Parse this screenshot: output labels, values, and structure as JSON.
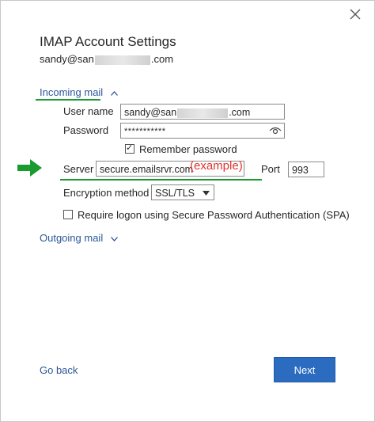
{
  "dialog": {
    "title": "IMAP Account Settings",
    "email_prefix": "sandy@san",
    "email_suffix": ".com"
  },
  "incoming": {
    "header": "Incoming mail",
    "chevron": "^",
    "username_label": "User name",
    "username_prefix": "sandy@san",
    "username_suffix": ".com",
    "password_label": "Password",
    "password_value": "***********",
    "remember_label": "Remember password",
    "remember_checked": true,
    "server_label": "Server",
    "server_value": "secure.emailsrvr.com",
    "server_annotation": "(example)",
    "port_label": "Port",
    "port_value": "993",
    "encryption_label": "Encryption method",
    "encryption_value": "SSL/TLS",
    "spa_label": "Require logon using Secure Password Authentication (SPA)",
    "spa_checked": false
  },
  "outgoing": {
    "header": "Outgoing mail",
    "chevron": "v"
  },
  "footer": {
    "back_label": "Go back",
    "next_label": "Next"
  },
  "colors": {
    "accent": "#2b579a",
    "next_button": "#2b6cc0",
    "annotation_green": "#1a9b30",
    "annotation_red": "#e0332e"
  },
  "icons": [
    "close-icon",
    "eye-icon",
    "checkmark-icon",
    "chevron-up-icon",
    "chevron-down-icon",
    "arrow-right-icon"
  ]
}
